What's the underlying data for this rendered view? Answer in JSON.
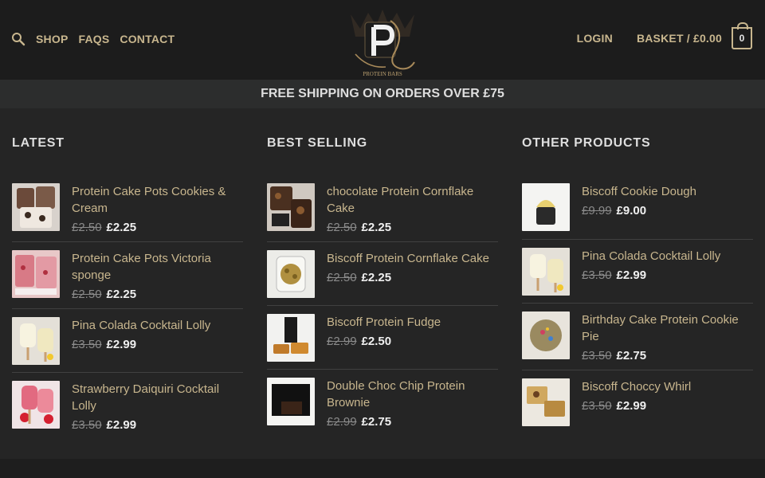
{
  "header": {
    "search_icon": "search-icon",
    "nav": [
      "SHOP",
      "FAQS",
      "CONTACT"
    ],
    "logo_text": "PROTEIN BARS",
    "login": "LOGIN",
    "basket": "BASKET / £0.00",
    "basket_count": "0"
  },
  "promo": "FREE SHIPPING ON ORDERS OVER £75",
  "columns": [
    {
      "title": "LATEST",
      "items": [
        {
          "name": "Protein Cake Pots Cookies & Cream",
          "old_price": "£2.50",
          "price": "£2.25"
        },
        {
          "name": "Protein Cake Pots Victoria sponge",
          "old_price": "£2.50",
          "price": "£2.25"
        },
        {
          "name": "Pina Colada Cocktail Lolly",
          "old_price": "£3.50",
          "price": "£2.99"
        },
        {
          "name": "Strawberry Daiquiri Cocktail Lolly",
          "old_price": "£3.50",
          "price": "£2.99"
        }
      ]
    },
    {
      "title": "BEST SELLING",
      "items": [
        {
          "name": "chocolate Protein Cornflake Cake",
          "old_price": "£2.50",
          "price": "£2.25"
        },
        {
          "name": "Biscoff Protein Cornflake Cake",
          "old_price": "£2.50",
          "price": "£2.25"
        },
        {
          "name": "Biscoff Protein Fudge",
          "old_price": "£2.99",
          "price": "£2.50"
        },
        {
          "name": "Double Choc Chip Protein Brownie",
          "old_price": "£2.99",
          "price": "£2.75"
        }
      ]
    },
    {
      "title": "OTHER PRODUCTS",
      "items": [
        {
          "name": "Biscoff Cookie Dough",
          "old_price": "£9.99",
          "price": "£9.00"
        },
        {
          "name": "Pina Colada Cocktail Lolly",
          "old_price": "£3.50",
          "price": "£2.99"
        },
        {
          "name": "Birthday Cake Protein Cookie Pie",
          "old_price": "£3.50",
          "price": "£2.75"
        },
        {
          "name": "Biscoff Choccy Whirl",
          "old_price": "£3.50",
          "price": "£2.99"
        }
      ]
    }
  ],
  "colors": {
    "background": "#252525",
    "header": "#1c1c1c",
    "accent_gold": "#c8b68e"
  }
}
